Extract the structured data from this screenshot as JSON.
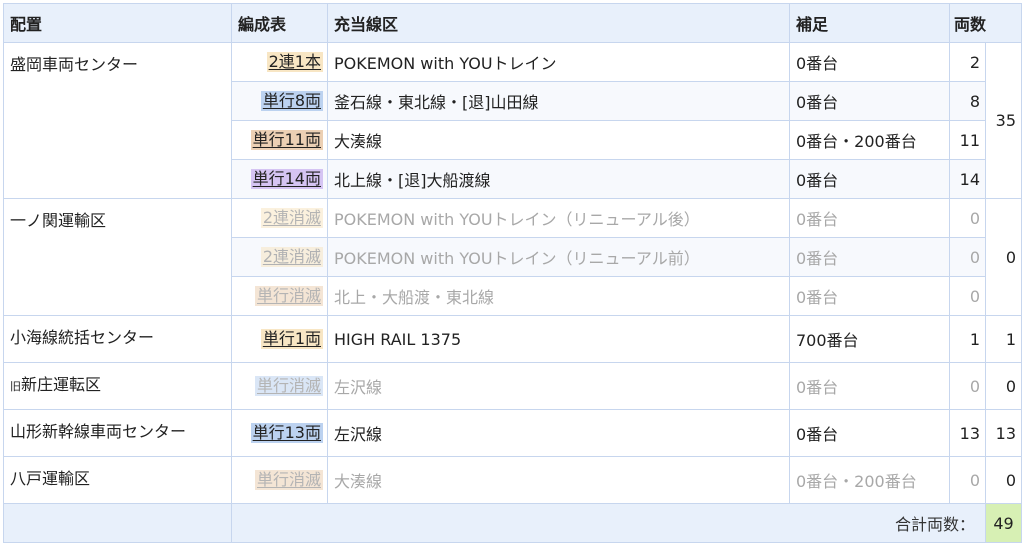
{
  "headers": {
    "depot": "配置",
    "formation": "編成表",
    "route": "充当線区",
    "note": "補足",
    "count": "両数"
  },
  "groups": [
    {
      "depot_prefix": "",
      "depot": "盛岡車両センター",
      "total": "35",
      "rows": [
        {
          "formation": "2連1本",
          "badge_color": "#f8e6c4",
          "route": "POKEMON with YOUトレイン",
          "note": "0番台",
          "count": "2",
          "dim": false
        },
        {
          "formation": "単行8両",
          "badge_color": "#bcd2f0",
          "route": "釜石線・東北線・[退]山田線",
          "note": "0番台",
          "count": "8",
          "dim": false
        },
        {
          "formation": "単行11両",
          "badge_color": "#ecd0b4",
          "route": "大湊線",
          "note": "0番台・200番台",
          "count": "11",
          "dim": false
        },
        {
          "formation": "単行14両",
          "badge_color": "#d5c4f3",
          "route": "北上線・[退]大船渡線",
          "note": "0番台",
          "count": "14",
          "dim": false
        }
      ]
    },
    {
      "depot_prefix": "",
      "depot": "一ノ関運輸区",
      "total": "0",
      "rows": [
        {
          "formation": "2連消滅",
          "badge_color": "#f8e6c4",
          "route": "POKEMON with YOUトレイン（リニューアル後）",
          "note": "0番台",
          "count": "0",
          "dim": true
        },
        {
          "formation": "2連消滅",
          "badge_color": "#f8e6c4",
          "route": "POKEMON with YOUトレイン（リニューアル前）",
          "note": "0番台",
          "count": "0",
          "dim": true
        },
        {
          "formation": "単行消滅",
          "badge_color": "#ecd0b4",
          "route": "北上・大船渡・東北線",
          "note": "0番台",
          "count": "0",
          "dim": true
        }
      ]
    },
    {
      "depot_prefix": "",
      "depot": "小海線統括センター",
      "total": "1",
      "rows": [
        {
          "formation": "単行1両",
          "badge_color": "#f8e6c4",
          "route": "HIGH RAIL 1375",
          "note": "700番台",
          "count": "1",
          "dim": false
        }
      ]
    },
    {
      "depot_prefix": "旧",
      "depot": "新庄運転区",
      "total": "0",
      "rows": [
        {
          "formation": "単行消滅",
          "badge_color": "#bcd2f0",
          "route": "左沢線",
          "note": "0番台",
          "count": "0",
          "dim": true
        }
      ]
    },
    {
      "depot_prefix": "",
      "depot": "山形新幹線車両センター",
      "total": "13",
      "rows": [
        {
          "formation": "単行13両",
          "badge_color": "#bcd2f0",
          "route": "左沢線",
          "note": "0番台",
          "count": "13",
          "dim": false
        }
      ]
    },
    {
      "depot_prefix": "",
      "depot": "八戸運輸区",
      "total": "0",
      "rows": [
        {
          "formation": "単行消滅",
          "badge_color": "#ecd0b4",
          "route": "大湊線",
          "note": "0番台・200番台",
          "count": "0",
          "dim": true
        }
      ]
    }
  ],
  "footer": {
    "label": "合計両数：",
    "value": "49"
  }
}
